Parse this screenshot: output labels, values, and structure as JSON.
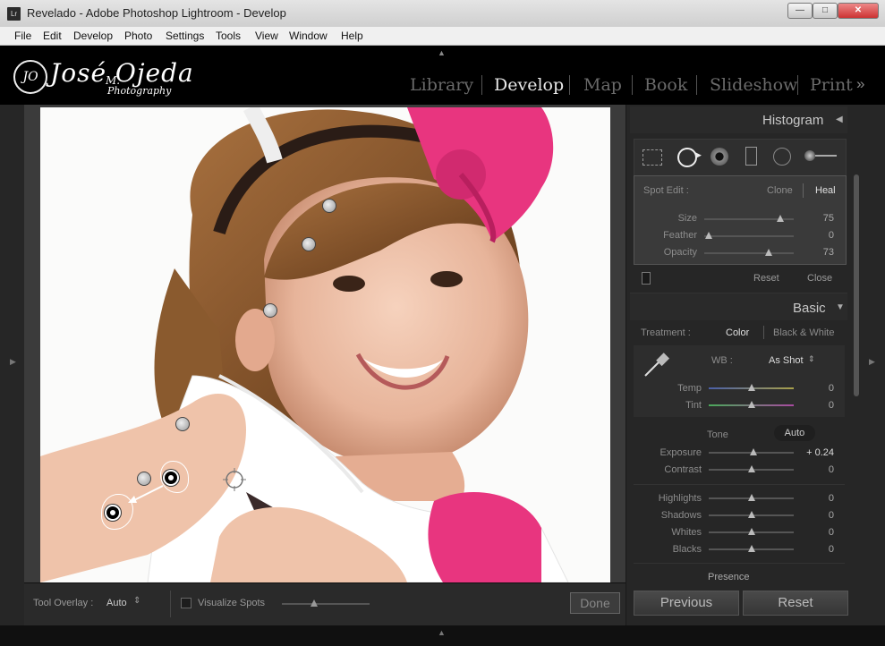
{
  "window": {
    "title": "Revelado - Adobe Photoshop Lightroom - Develop",
    "app_icon": "Lr"
  },
  "menu": [
    "File",
    "Edit",
    "Develop",
    "Photo",
    "Settings",
    "Tools",
    "View",
    "Window",
    "Help"
  ],
  "branding": {
    "mark": "JO",
    "name": "José Ojeda",
    "middle_initial": "M.",
    "subtitle": "Photography"
  },
  "modules": [
    "Library",
    "Develop",
    "Map",
    "Book",
    "Slideshow",
    "Print"
  ],
  "active_module": "Develop",
  "histogram": {
    "title": "Histogram"
  },
  "spot_edit": {
    "label": "Spot Edit :",
    "modes": [
      "Clone",
      "Heal"
    ],
    "active_mode": "Heal",
    "sliders": [
      {
        "name": "Size",
        "value": "75",
        "pos": 0.85
      },
      {
        "name": "Feather",
        "value": "0",
        "pos": 0.05
      },
      {
        "name": "Opacity",
        "value": "73",
        "pos": 0.72
      }
    ],
    "reset": "Reset",
    "close": "Close"
  },
  "basic": {
    "title": "Basic",
    "treatment_label": "Treatment :",
    "treatment_options": [
      "Color",
      "Black & White"
    ],
    "treatment_active": "Color",
    "wb_label": "WB :",
    "wb_value": "As Shot",
    "wb_sliders": [
      {
        "name": "Temp",
        "value": "0",
        "pos": 0.5
      },
      {
        "name": "Tint",
        "value": "0",
        "pos": 0.5
      }
    ],
    "tone_label": "Tone",
    "auto_label": "Auto",
    "tone_sliders": [
      {
        "name": "Exposure",
        "value": "+ 0.24",
        "pos": 0.53
      },
      {
        "name": "Contrast",
        "value": "0",
        "pos": 0.5
      }
    ],
    "presence_sliders": [
      {
        "name": "Highlights",
        "value": "0",
        "pos": 0.5
      },
      {
        "name": "Shadows",
        "value": "0",
        "pos": 0.5
      },
      {
        "name": "Whites",
        "value": "0",
        "pos": 0.5
      },
      {
        "name": "Blacks",
        "value": "0",
        "pos": 0.5
      }
    ],
    "presence_label": "Presence"
  },
  "toolbar": {
    "tool_overlay_label": "Tool Overlay :",
    "tool_overlay_value": "Auto",
    "visualize_spots": "Visualize Spots",
    "done": "Done"
  },
  "buttons": {
    "previous": "Previous",
    "reset": "Reset"
  }
}
